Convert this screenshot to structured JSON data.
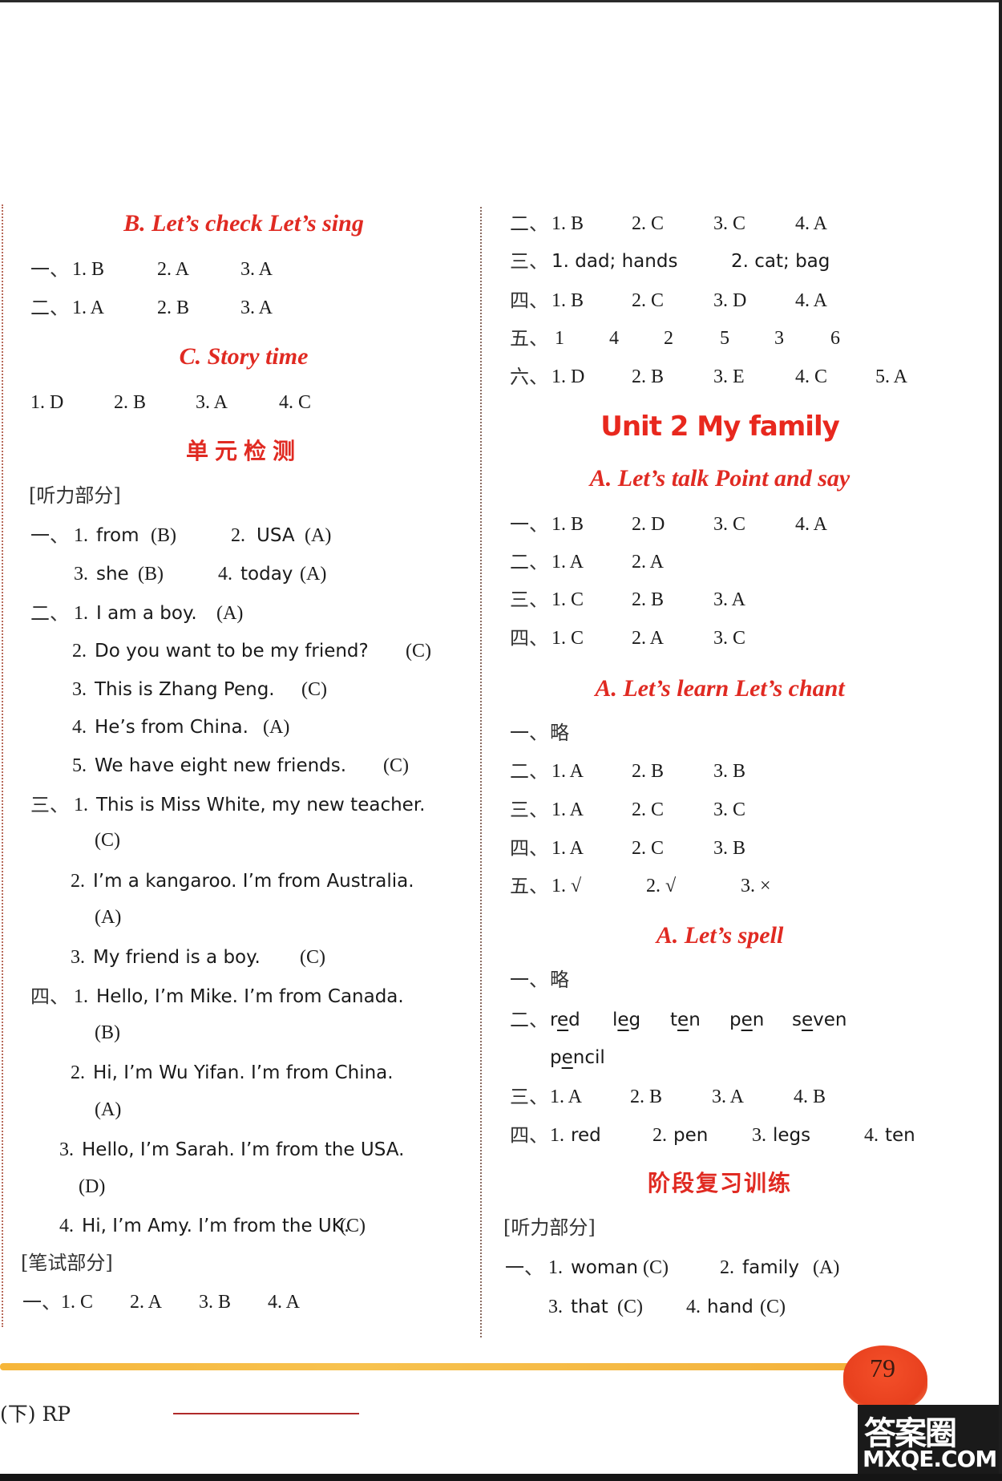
{
  "left": {
    "b_check_heading": "B. Let’s check  Let’s sing",
    "b_check": [
      {
        "label": "一、",
        "items": [
          "1. B",
          "2. A",
          "3. A"
        ]
      },
      {
        "label": "二、",
        "items": [
          "1. A",
          "2. B",
          "3. A"
        ]
      }
    ],
    "c_story_heading": "C. Story time",
    "c_story": {
      "items": [
        "1. D",
        "2. B",
        "3. A",
        "4. C"
      ]
    },
    "unit_test_heading": "单元检测",
    "listening_label": "[听力部分]",
    "q1": {
      "label": "一、",
      "row1": [
        {
          "num": "1.",
          "word": "from",
          "ans": "(B)"
        },
        {
          "num": "2.",
          "word": "USA",
          "ans": "(A)"
        }
      ],
      "row2": [
        {
          "num": "3.",
          "word": "she",
          "ans": "(B)"
        },
        {
          "num": "4.",
          "word": "today",
          "ans": "(A)"
        }
      ]
    },
    "q2": {
      "label": "二、",
      "items": [
        {
          "num": "1.",
          "text": "I am a boy.",
          "ans": "(A)"
        },
        {
          "num": "2.",
          "text": "Do you want to be my friend?",
          "ans": "(C)"
        },
        {
          "num": "3.",
          "text": "This is Zhang Peng.",
          "ans": "(C)"
        },
        {
          "num": "4.",
          "text": "He’s from China.",
          "ans": "(A)"
        },
        {
          "num": "5.",
          "text": "We have eight new friends.",
          "ans": "(C)"
        }
      ]
    },
    "q3": {
      "label": "三、",
      "items": [
        {
          "num": "1.",
          "text": "This is Miss White, my new teacher.",
          "ans": "(C)"
        },
        {
          "num": "2.",
          "text": "I’m a kangaroo. I’m from Australia.",
          "ans": "(A)"
        },
        {
          "num": "3.",
          "text": "My friend is a boy.",
          "ans": "(C)"
        }
      ]
    },
    "q4": {
      "label": "四、",
      "items": [
        {
          "num": "1.",
          "text": "Hello, I’m Mike. I’m from Canada.",
          "ans": "(B)"
        },
        {
          "num": "2.",
          "text": "Hi, I’m Wu Yifan. I’m from China.",
          "ans": "(A)"
        },
        {
          "num": "3.",
          "text": "Hello, I’m Sarah. I’m from the USA.",
          "ans": "(D)"
        },
        {
          "num": "4.",
          "text": "Hi, I’m Amy. I’m from the UK.",
          "ans": "(C)"
        }
      ]
    },
    "written_label": "[笔试部分]",
    "w1": {
      "label": "一、",
      "items": [
        "1. C",
        "2. A",
        "3. B",
        "4. A"
      ]
    }
  },
  "right": {
    "top_rows": [
      {
        "label": "二、",
        "items": [
          "1. B",
          "2. C",
          "3. C",
          "4. A"
        ]
      },
      {
        "label": "三、",
        "items": [
          "1. dad; hands",
          "2. cat; bag"
        ]
      },
      {
        "label": "四、",
        "items": [
          "1. B",
          "2. C",
          "3. D",
          "4. A"
        ]
      },
      {
        "label": "五、",
        "items": [
          "1",
          "4",
          "2",
          "5",
          "3",
          "6"
        ]
      },
      {
        "label": "六、",
        "items": [
          "1. D",
          "2. B",
          "3. E",
          "4. C",
          "5. A"
        ]
      }
    ],
    "unit_title": "Unit 2    My family",
    "talk_heading": "A. Let’s talk  Point and say",
    "talk_rows": [
      {
        "label": "一、",
        "items": [
          "1. B",
          "2. D",
          "3. C",
          "4. A"
        ]
      },
      {
        "label": "二、",
        "items": [
          "1. A",
          "2. A"
        ]
      },
      {
        "label": "三、",
        "items": [
          "1. C",
          "2. B",
          "3. A"
        ]
      },
      {
        "label": "四、",
        "items": [
          "1. C",
          "2. A",
          "3. C"
        ]
      }
    ],
    "learn_heading": "A. Let’s learn  Let’s chant",
    "learn_rows": [
      {
        "label": "一、",
        "items": [
          "略"
        ]
      },
      {
        "label": "二、",
        "items": [
          "1. A",
          "2. B",
          "3. B"
        ]
      },
      {
        "label": "三、",
        "items": [
          "1. A",
          "2. C",
          "3. C"
        ]
      },
      {
        "label": "四、",
        "items": [
          "1. A",
          "2. C",
          "3. B"
        ]
      },
      {
        "label": "五、",
        "items": [
          "1.  √",
          "2.  √",
          "3. ×"
        ]
      }
    ],
    "spell_heading": "A. Let’s spell",
    "spell": {
      "r1": {
        "label": "一、",
        "text": "略"
      },
      "r2": {
        "label": "二、",
        "words": [
          {
            "pre": "r",
            "u": "e",
            "post": "d"
          },
          {
            "pre": "l",
            "u": "e",
            "post": "g"
          },
          {
            "pre": "t",
            "u": "e",
            "post": "n"
          },
          {
            "pre": "p",
            "u": "e",
            "post": "n"
          },
          {
            "pre": "s",
            "u": "e",
            "post": "ven"
          },
          {
            "pre": "p",
            "u": "e",
            "post": "ncil"
          }
        ]
      },
      "r3": {
        "label": "三、",
        "items": [
          "1. A",
          "2. B",
          "3. A",
          "4. B"
        ]
      },
      "r4": {
        "label": "四、",
        "items": [
          {
            "num": "1.",
            "word": "red"
          },
          {
            "num": "2.",
            "word": "pen"
          },
          {
            "num": "3.",
            "word": "legs"
          },
          {
            "num": "4.",
            "word": "ten"
          }
        ]
      }
    },
    "review_heading": "阶段复习训练",
    "review_listening_label": "[听力部分]",
    "review_q1": {
      "label": "一、",
      "row1": [
        {
          "num": "1.",
          "word": "woman",
          "ans": "(C)"
        },
        {
          "num": "2.",
          "word": "family",
          "ans": "(A)"
        }
      ],
      "row2": [
        {
          "num": "3.",
          "word": "that",
          "ans": "(C)"
        },
        {
          "num": "4.",
          "word": "hand",
          "ans": "(C)"
        }
      ]
    }
  },
  "footer": {
    "edition": "(下)  RP",
    "page_number": "79",
    "watermark_cn": "答案圈",
    "watermark_en": "MXQE.COM",
    "accent_red": "#e02a22",
    "accent_orange": "#f6b63a"
  }
}
